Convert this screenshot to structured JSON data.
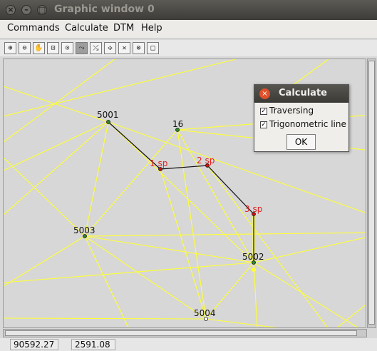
{
  "window": {
    "title": "Graphic window 0",
    "close_glyph": "×",
    "min_glyph": "–",
    "max_glyph": "□"
  },
  "menubar": {
    "items": [
      "Commands",
      "Calculate",
      "DTM",
      "Help"
    ]
  },
  "toolbar": {
    "tools": [
      "zoom-in-icon",
      "zoom-out-icon",
      "pan-hand-icon",
      "zoom-window-icon",
      "zoom-prev-icon",
      "draw-line-icon",
      "snap-icon",
      "select-point-icon",
      "cross-icon",
      "target-icon",
      "square-icon"
    ],
    "glyphs": [
      "⊕",
      "⊖",
      "✋",
      "⊡",
      "⊙",
      "⤳",
      "⤯",
      "✣",
      "✕",
      "⊗",
      "□"
    ],
    "active_index": 5
  },
  "graph": {
    "colors": {
      "lines": "#ffff33",
      "traverse": "#111111",
      "known_point": "#2e8b2e",
      "station": "#cc1111",
      "label": "#111111",
      "station_label": "#e02020"
    },
    "points": [
      {
        "id": "5001",
        "kind": "known"
      },
      {
        "id": "16",
        "kind": "known"
      },
      {
        "id": "1 sp",
        "kind": "station"
      },
      {
        "id": "2 sp",
        "kind": "station"
      },
      {
        "id": "3 sp",
        "kind": "station"
      },
      {
        "id": "5003",
        "kind": "known"
      },
      {
        "id": "5002",
        "kind": "known"
      },
      {
        "id": "5004",
        "kind": "known"
      }
    ]
  },
  "dialog": {
    "title": "Calculate",
    "close_glyph": "×",
    "options": [
      {
        "label": "Traversing",
        "checked": true
      },
      {
        "label": "Trigonometric line",
        "checked": true
      }
    ],
    "ok_label": "OK"
  },
  "status": {
    "x": "90592.27",
    "y": "2591.08"
  }
}
